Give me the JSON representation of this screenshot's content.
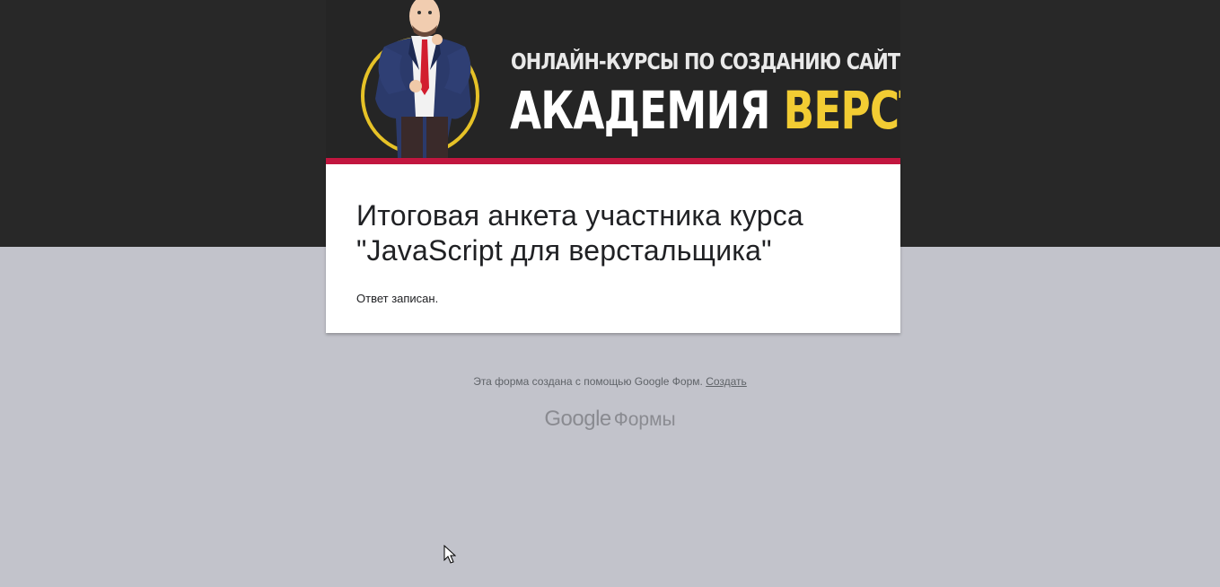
{
  "banner": {
    "subtitle": "ОНЛАЙН-КУРСЫ ПО СОЗДАНИЮ САЙТОВ",
    "title_part1": "АКАДЕМИЯ",
    "title_part2": "ВЕРСТКИ",
    "accent_color": "#f2cc33"
  },
  "form": {
    "title": "Итоговая анкета участника курса \"JavaScript для верстальщика\"",
    "response_message": "Ответ записан.",
    "accent_color": "#c2163f"
  },
  "footer": {
    "note": "Эта форма создана с помощью Google Форм.",
    "create_link": "Создать",
    "brand_google": "Google",
    "brand_forms": "Формы"
  }
}
